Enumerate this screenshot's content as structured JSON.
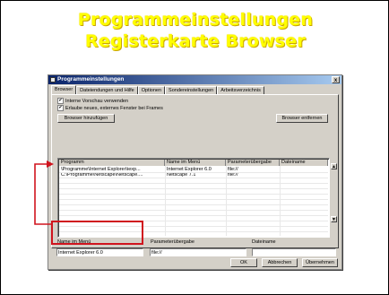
{
  "slide": {
    "title_line1": "Programmeinstellungen",
    "title_line2": "Registerkarte Browser",
    "title_color": "#ffff00",
    "highlight_color": "#d0141e"
  },
  "window": {
    "title": "Programmeinstellungen",
    "close_label": "x",
    "tabs": [
      "Browser",
      "Dateiendungen und Hilfe",
      "Optionen",
      "Sondereinstellungen",
      "Arbeitsverzeichnis"
    ],
    "checkboxes": [
      {
        "label": "Interne Vorschau verwenden",
        "checked": true
      },
      {
        "label": "Erlaube neues, externes Fenster bei Frames",
        "checked": true
      }
    ],
    "add_browser_label": "Browser hinzufügen",
    "remove_browser_label": "Browser entfernen",
    "columns": [
      "Programm",
      "Name im Menü",
      "Parameterübergabe",
      "Dateiname"
    ],
    "rows": [
      {
        "program": "\\Programme\\Internet Explorer\\iexp...",
        "menu_name": "Internet Explorer 6.0",
        "params": "file://",
        "file": ""
      },
      {
        "program": "C:\\Programme\\Netscape\\Netscape....",
        "menu_name": "Netscape 7.1",
        "params": "file://",
        "file": ""
      }
    ],
    "name_label": "Name im Menü",
    "name_value": "Internet Explorer 6.0",
    "param_label": "Parameterübergabe",
    "param_value": "file://",
    "file_label": "Dateiname",
    "file_value": "",
    "ok_label": "OK",
    "cancel_label": "Abbrechen",
    "apply_label": "Übernehmen"
  }
}
